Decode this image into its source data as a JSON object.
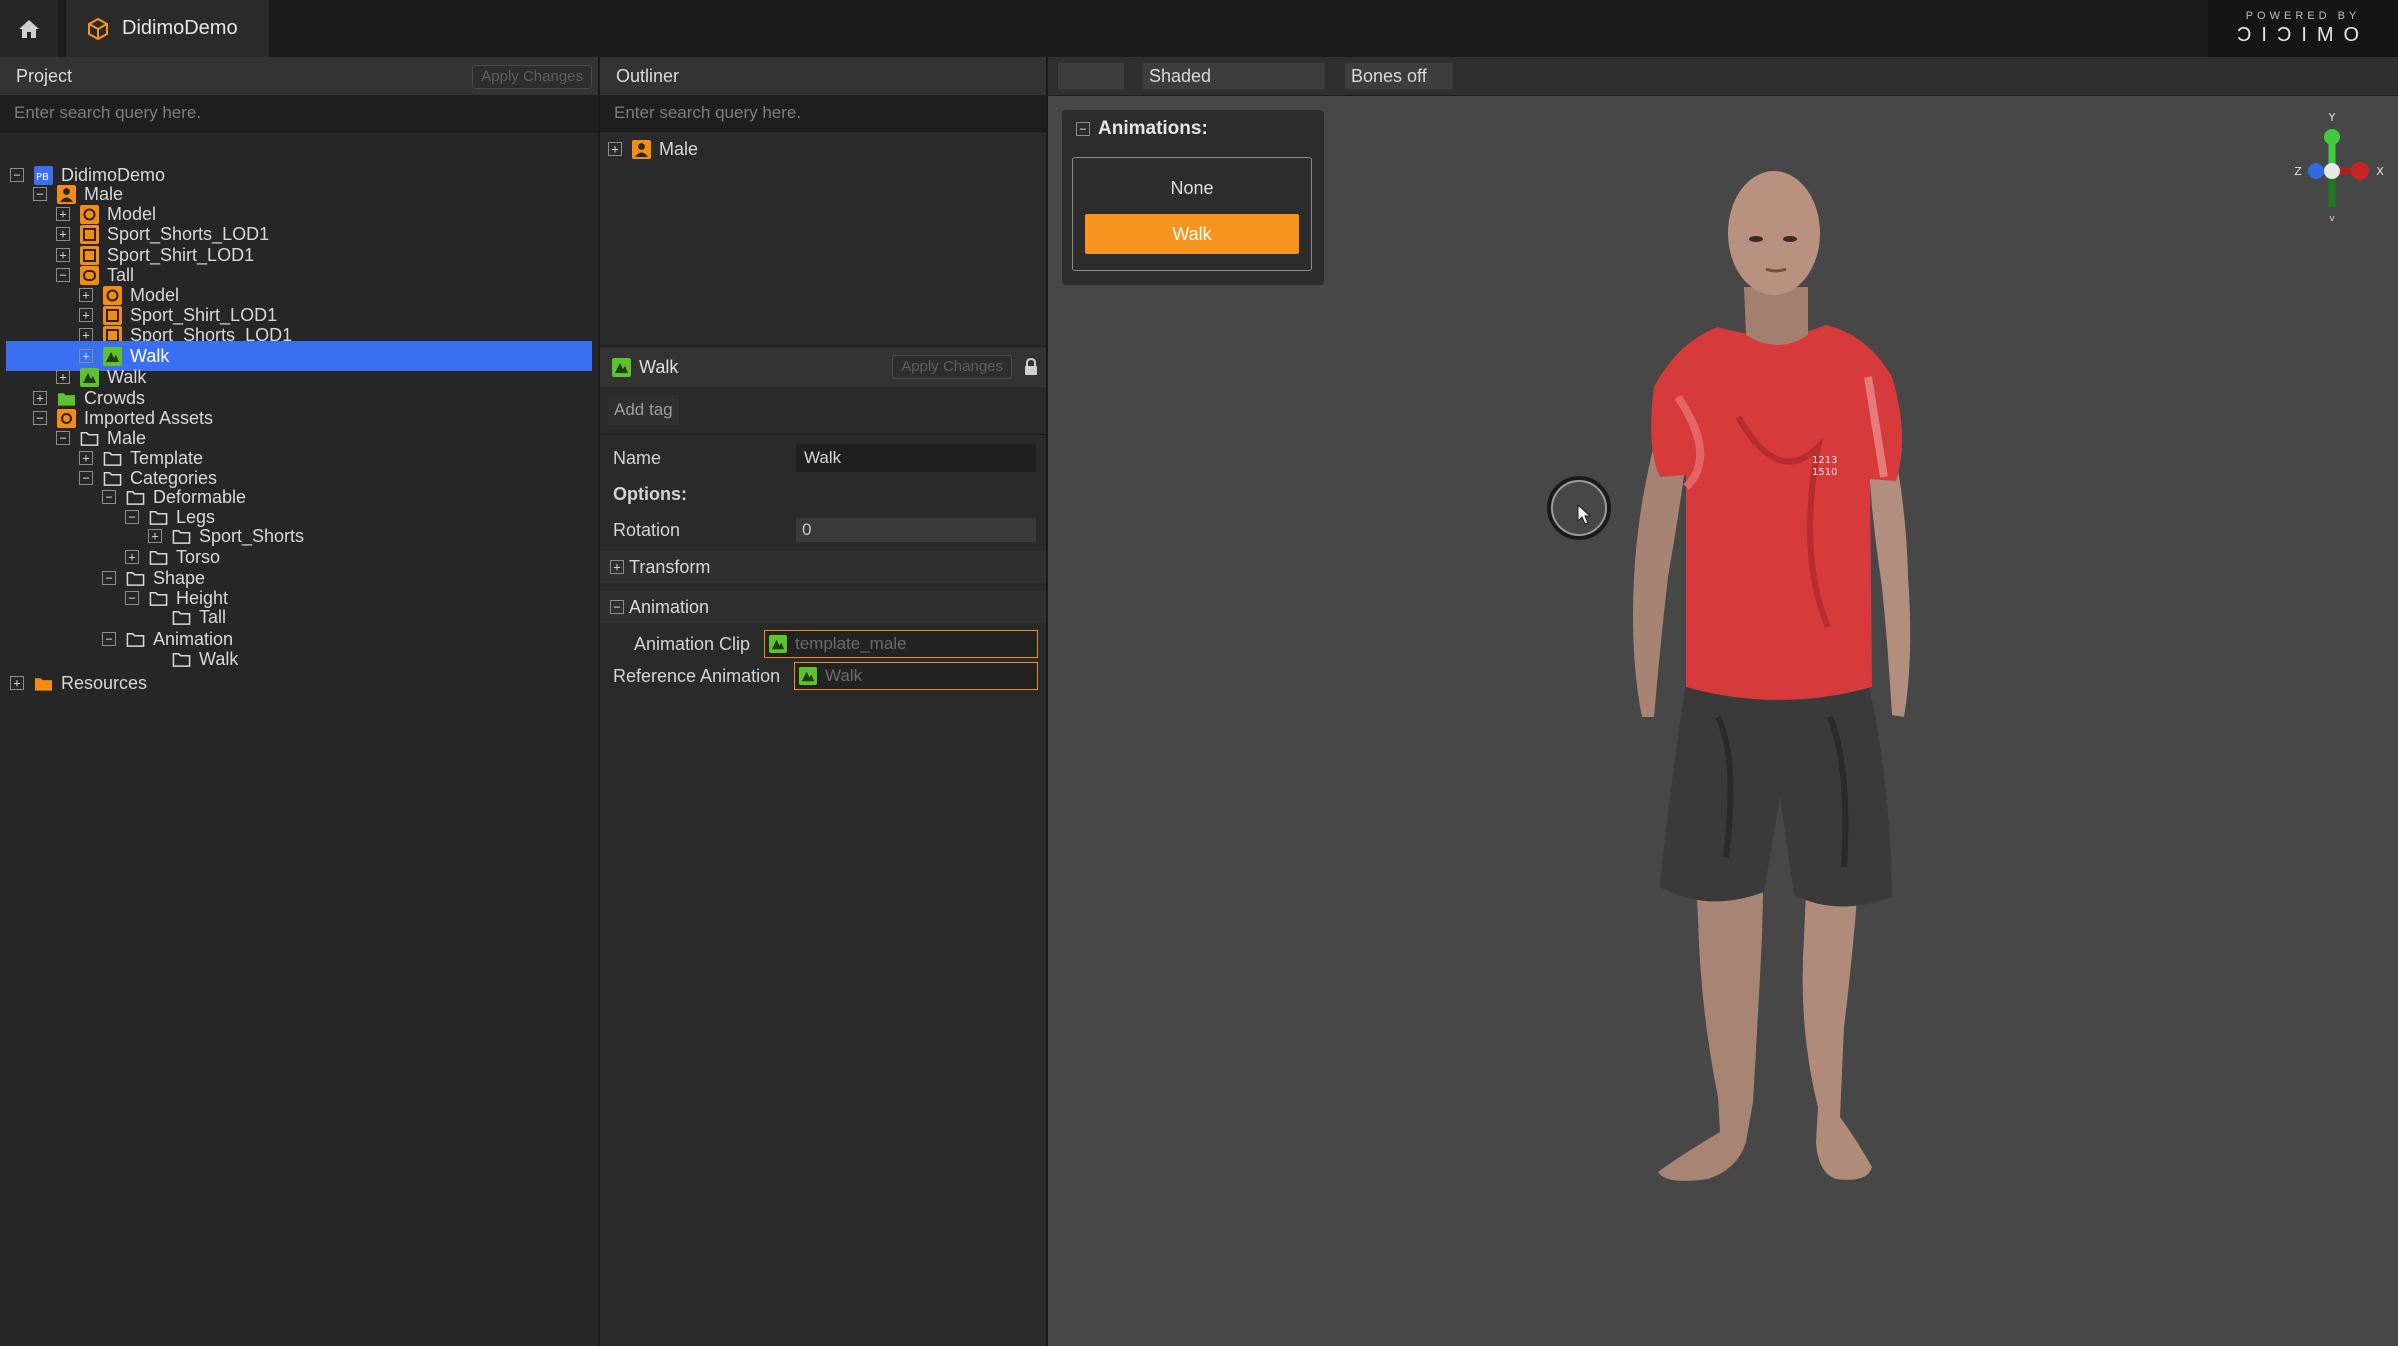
{
  "window": {
    "tab_title": "DidimoDemo",
    "brand_small": "POWERED BY",
    "brand_big": "ƆIƆIMO"
  },
  "project": {
    "title": "Project",
    "apply_label": "Apply Changes",
    "search_placeholder": "Enter search query here.",
    "tree": [
      {
        "label": "DidimoDemo",
        "icon": "project-icon",
        "expander": "−"
      },
      {
        "label": "Male",
        "icon": "character-icon",
        "expander": "−"
      },
      {
        "label": "Model",
        "icon": "model-icon",
        "expander": "+"
      },
      {
        "label": "Sport_Shorts_LOD1",
        "icon": "mesh-icon",
        "expander": "+"
      },
      {
        "label": "Sport_Shirt_LOD1",
        "icon": "mesh-icon",
        "expander": "+"
      },
      {
        "label": "Tall",
        "icon": "variant-icon",
        "expander": "−"
      },
      {
        "label": "Model",
        "icon": "model-icon",
        "expander": "+"
      },
      {
        "label": "Sport_Shirt_LOD1",
        "icon": "mesh-icon",
        "expander": "+"
      },
      {
        "label": "Sport_Shorts_LOD1",
        "icon": "mesh-icon",
        "expander": "+"
      },
      {
        "label": "Walk",
        "icon": "animation-icon",
        "expander": "+",
        "selected": true
      },
      {
        "label": "Walk",
        "icon": "animation-icon",
        "expander": "+"
      },
      {
        "label": "Crowds",
        "icon": "crowd-folder-icon",
        "expander": "+"
      },
      {
        "label": "Imported Assets",
        "icon": "imported-assets-icon",
        "expander": "−"
      },
      {
        "label": "Male",
        "icon": "folder-icon",
        "expander": "−"
      },
      {
        "label": "Template",
        "icon": "folder-icon",
        "expander": "+"
      },
      {
        "label": "Categories",
        "icon": "folder-icon",
        "expander": "−"
      },
      {
        "label": "Deformable",
        "icon": "folder-icon",
        "expander": "−"
      },
      {
        "label": "Legs",
        "icon": "folder-icon",
        "expander": "−"
      },
      {
        "label": "Sport_Shorts",
        "icon": "folder-icon",
        "expander": "+"
      },
      {
        "label": "Torso",
        "icon": "folder-icon",
        "expander": "+"
      },
      {
        "label": "Shape",
        "icon": "folder-icon",
        "expander": "−"
      },
      {
        "label": "Height",
        "icon": "folder-icon",
        "expander": "−"
      },
      {
        "label": "Tall",
        "icon": "folder-icon",
        "expander": ""
      },
      {
        "label": "Animation",
        "icon": "folder-icon",
        "expander": "−"
      },
      {
        "label": "Walk",
        "icon": "folder-icon",
        "expander": ""
      },
      {
        "label": "Resources",
        "icon": "resources-icon",
        "expander": "+"
      }
    ]
  },
  "outliner": {
    "title": "Outliner",
    "search_placeholder": "Enter search query here.",
    "root_label": "Male",
    "root_expander": "+"
  },
  "inspector": {
    "title": "Walk",
    "apply_label": "Apply Changes",
    "add_tag_label": "Add tag",
    "name_label": "Name",
    "name_value": "Walk",
    "options_label": "Options:",
    "rotation_label": "Rotation",
    "rotation_value": "0",
    "transform_label": "Transform",
    "transform_expander": "+",
    "animation_label": "Animation",
    "animation_expander": "−",
    "clip_label": "Animation Clip",
    "clip_value": "template_male",
    "reference_label": "Reference Animation",
    "reference_value": "Walk"
  },
  "viewport": {
    "shading_mode": "Shaded",
    "bones_mode": "Bones off",
    "animations_title": "Animations:",
    "animations_expander": "−",
    "animation_options": [
      {
        "label": "None",
        "active": false
      },
      {
        "label": "Walk",
        "active": true
      }
    ],
    "shirt_print": "1213\n1510",
    "gizmo_axes": {
      "x": "X",
      "y": "Y",
      "z": "Z"
    }
  },
  "colors": {
    "selection": "#3b6ff1",
    "accent": "#f7941d",
    "viewport_bg": "#474747",
    "shirt": "#d63a3a"
  }
}
